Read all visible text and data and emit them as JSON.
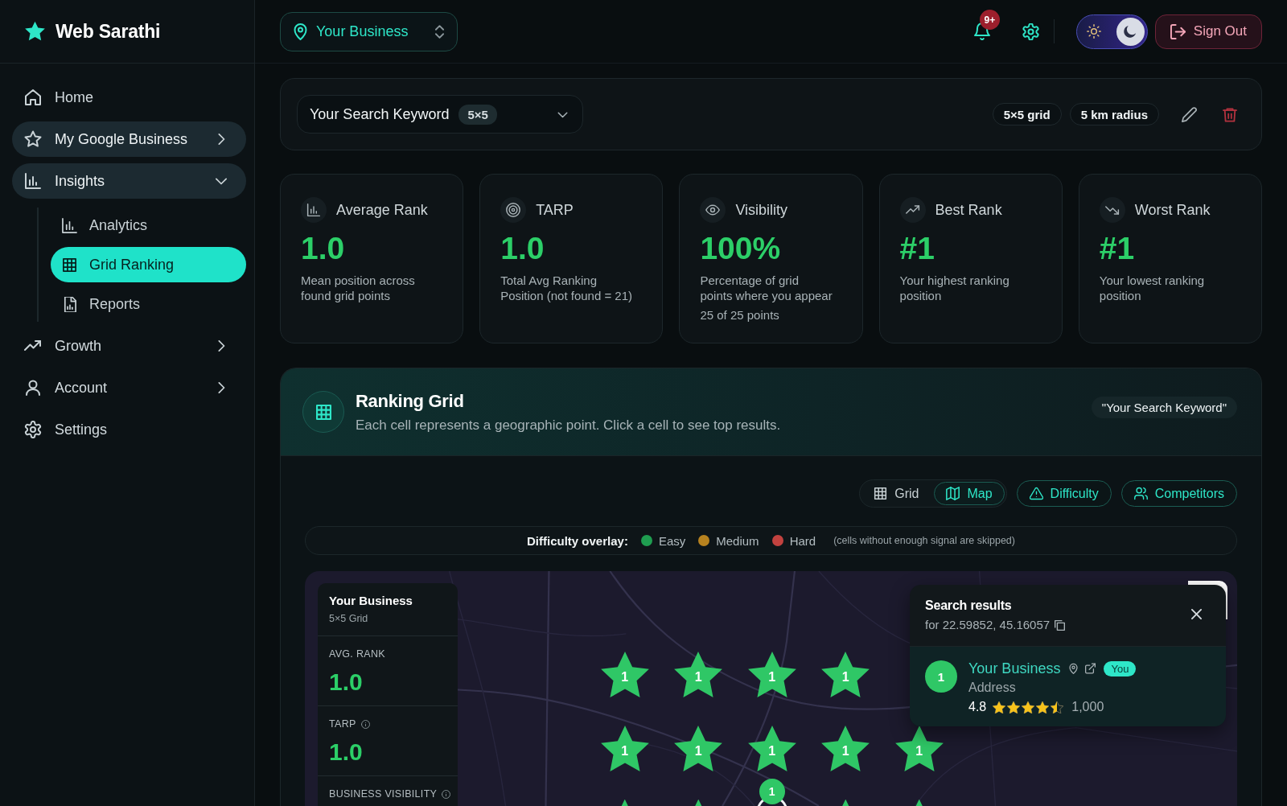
{
  "app": {
    "name": "Web Sarathi"
  },
  "sidebar": {
    "items": [
      {
        "kind": "link",
        "label": "Home",
        "selected": false,
        "highlighted": false
      },
      {
        "kind": "group",
        "label": "My Google Business",
        "selected": false,
        "highlighted": true,
        "expanded": false
      },
      {
        "kind": "group",
        "label": "Insights",
        "selected": false,
        "highlighted": true,
        "expanded": true,
        "children": [
          {
            "label": "Analytics",
            "selected": false
          },
          {
            "label": "Grid Ranking",
            "selected": true
          },
          {
            "label": "Reports",
            "selected": false
          }
        ]
      },
      {
        "kind": "group",
        "label": "Growth",
        "selected": false,
        "highlighted": false,
        "expanded": false
      },
      {
        "kind": "group",
        "label": "Account",
        "selected": false,
        "highlighted": false,
        "expanded": false
      },
      {
        "kind": "link",
        "label": "Settings",
        "selected": false,
        "highlighted": false
      }
    ]
  },
  "top_bar": {
    "business_selector": {
      "label": "Your Business"
    },
    "notifications": {
      "badge": "9+"
    },
    "theme_toggle": {
      "dark": true
    },
    "sign_out": {
      "label": "Sign Out"
    }
  },
  "keyword_bar": {
    "keyword": "Your Search Keyword",
    "grid_badge": "5×5",
    "chips": [
      "5×5 grid",
      "5 km radius"
    ]
  },
  "metrics": [
    {
      "title": "Average Rank",
      "value": "1.0",
      "description": "Mean position across found grid points"
    },
    {
      "title": "TARP",
      "value": "1.0",
      "description": "Total Avg Ranking Position (not found = 21)"
    },
    {
      "title": "Visibility",
      "value": "100%",
      "description": "Percentage of grid points where you appear",
      "note": "25 of 25 points"
    },
    {
      "title": "Best Rank",
      "value": "#1",
      "description": "Your highest ranking position"
    },
    {
      "title": "Worst Rank",
      "value": "#1",
      "description": "Your lowest ranking position"
    }
  ],
  "ranking_grid": {
    "title": "Ranking Grid",
    "subtitle": "Each cell represents a geographic point. Click a cell to see top results.",
    "keyword_chip": "\"Your Search Keyword\"",
    "view_tabs": [
      {
        "label": "Grid",
        "selected": false
      },
      {
        "label": "Map",
        "selected": true
      }
    ],
    "actions": [
      {
        "label": "Difficulty"
      },
      {
        "label": "Competitors"
      }
    ],
    "difficulty_legend": {
      "label": "Difficulty overlay:",
      "levels": [
        {
          "label": "Easy",
          "color": "#1f9d50"
        },
        {
          "label": "Medium",
          "color": "#b7821f"
        },
        {
          "label": "Hard",
          "color": "#c2423f"
        }
      ],
      "note": "(cells without enough signal are skipped)"
    },
    "map": {
      "summary_panel": {
        "title": "Your Business",
        "subtitle": "5×5 Grid",
        "stats": [
          {
            "label": "AVG. RANK",
            "value": "1.0",
            "info": false
          },
          {
            "label": "TARP",
            "value": "1.0",
            "info": true
          },
          {
            "label": "BUSINESS VISIBILITY",
            "info": true
          }
        ]
      },
      "grid_points": [
        [
          {
            "rank": "1",
            "selected": false
          },
          {
            "rank": "1",
            "selected": false
          },
          {
            "rank": "1",
            "selected": false
          },
          {
            "rank": "1",
            "selected": false
          }
        ],
        [
          {
            "rank": "1",
            "selected": false
          },
          {
            "rank": "1",
            "selected": false
          },
          {
            "rank": "1",
            "selected": false
          },
          {
            "rank": "1",
            "selected": false
          },
          {
            "rank": "1",
            "selected": false
          }
        ],
        [
          {
            "selected": false
          },
          {
            "selected": false
          },
          {
            "rank": "1",
            "selected": true
          },
          {
            "selected": false
          },
          {
            "selected": false
          }
        ]
      ],
      "search_results": {
        "title": "Search results",
        "coordinates": "for 22.59852, 45.16057",
        "results": [
          {
            "rank": "1",
            "name": "Your Business",
            "you_badge": "You",
            "address": "Address",
            "rating": "4.8",
            "stars": 4.5,
            "reviews": "1,000"
          }
        ]
      }
    }
  }
}
